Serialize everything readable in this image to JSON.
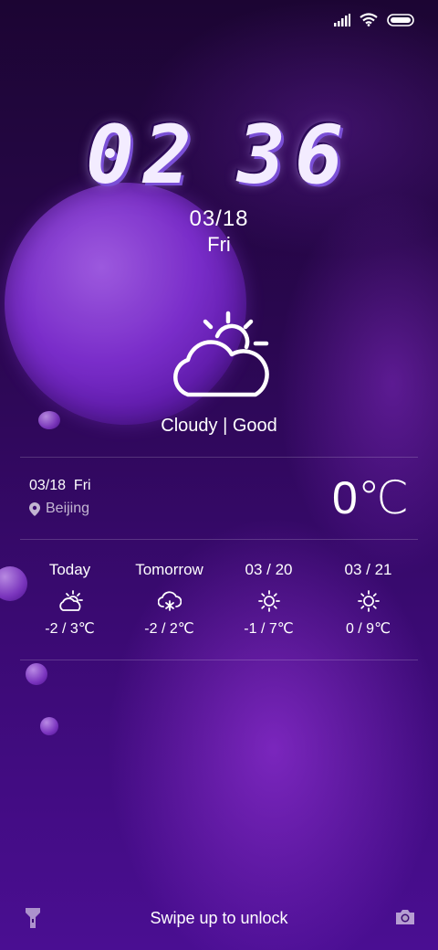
{
  "status": {
    "signal_icon": "signal-icon",
    "wifi_icon": "wifi-icon",
    "battery_icon": "battery-icon"
  },
  "clock": {
    "hour": "02",
    "minute": "36"
  },
  "date": {
    "short": "03/18",
    "weekday": "Fri"
  },
  "weather": {
    "icon": "partly-cloudy-icon",
    "condition": "Cloudy | Good",
    "date_line": "03/18  Fri",
    "location": "Beijing",
    "temperature": "0℃"
  },
  "forecast": [
    {
      "day": "Today",
      "icon": "partly-cloudy-icon",
      "range": "-2 / 3℃"
    },
    {
      "day": "Tomorrow",
      "icon": "snow-cloud-icon",
      "range": "-2 / 2℃"
    },
    {
      "day": "03 / 20",
      "icon": "sun-icon",
      "range": "-1 / 7℃"
    },
    {
      "day": "03 / 21",
      "icon": "sun-icon",
      "range": "0 / 9℃"
    }
  ],
  "bottom": {
    "unlock_text": "Swipe up to unlock",
    "flashlight_icon": "flashlight-icon",
    "camera_icon": "camera-icon"
  },
  "colors": {
    "background": "#2a0750",
    "accent": "#7e2fd0",
    "text": "#ffffff"
  }
}
